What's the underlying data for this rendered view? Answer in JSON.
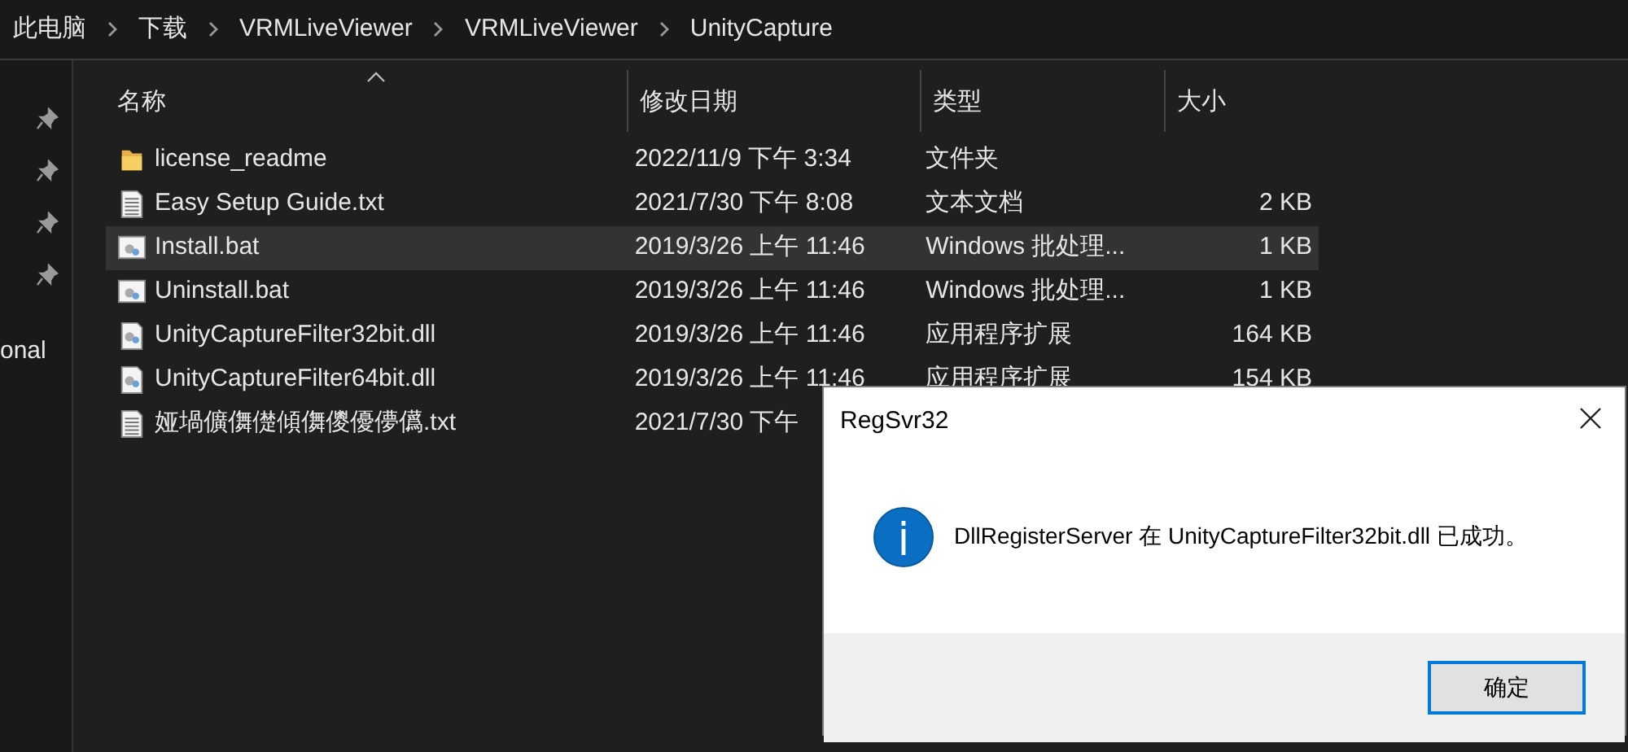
{
  "breadcrumb": [
    "此电脑",
    "下载",
    "VRMLiveViewer",
    "VRMLiveViewer",
    "UnityCapture"
  ],
  "sidebar": [
    {
      "kind": "pin"
    },
    {
      "kind": "pin"
    },
    {
      "kind": "pin"
    },
    {
      "kind": "pin"
    },
    {
      "kind": "label",
      "label": "onal"
    }
  ],
  "columns": [
    {
      "label": "名称",
      "sorted": true
    },
    {
      "label": "修改日期",
      "sorted": false
    },
    {
      "label": "类型",
      "sorted": false
    },
    {
      "label": "大小",
      "sorted": false
    }
  ],
  "rows": [
    {
      "kind": "folder",
      "name": "license_readme",
      "date": "2022/11/9 下午 3:34",
      "type": "文件夹",
      "selected": false
    },
    {
      "kind": "text",
      "name": "Easy Setup Guide.txt",
      "date": "2021/7/30 下午 8:08",
      "type": "文本文档",
      "size": "2 KB",
      "selected": false
    },
    {
      "kind": "batch",
      "name": "Install.bat",
      "date": "2019/3/26 上午 11:46",
      "type": "Windows 批处理...",
      "size": "1 KB",
      "selected": true
    },
    {
      "kind": "batch",
      "name": "Uninstall.bat",
      "date": "2019/3/26 上午 11:46",
      "type": "Windows 批处理...",
      "size": "1 KB",
      "selected": false
    },
    {
      "kind": "library",
      "name": "UnityCaptureFilter32bit.dll",
      "date": "2019/3/26 上午 11:46",
      "type": "应用程序扩展",
      "size": "164 KB",
      "selected": false
    },
    {
      "kind": "library",
      "name": "UnityCaptureFilter64bit.dll",
      "date": "2019/3/26 上午 11:46",
      "type": "应用程序扩展",
      "size": "154 KB",
      "selected": false
    },
    {
      "kind": "text",
      "name": "娅堝儣儛儊傾儛儍優儚儰.txt",
      "date": "2021/7/30 下午",
      "selected": false
    }
  ],
  "dialog": {
    "title": "RegSvr32",
    "kind": "info",
    "message": "DllRegisterServer 在 UnityCaptureFilter32bit.dll 已成功。",
    "button": "确定"
  }
}
